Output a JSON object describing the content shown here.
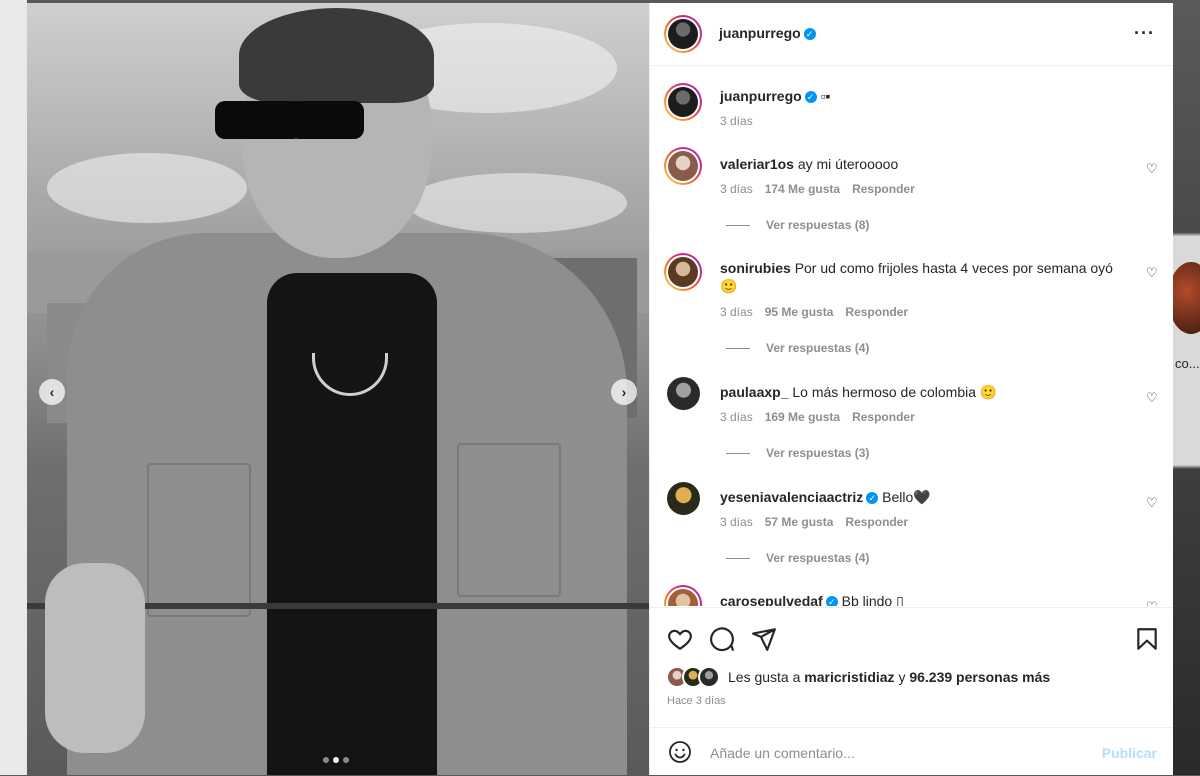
{
  "post": {
    "username": "juanpurrego",
    "caption": "▫▪",
    "caption_time": "3 días",
    "more_icon": "more-horizontal-icon"
  },
  "backdrop": {
    "snippet": "co..."
  },
  "comments": [
    {
      "username": "valeriar1os",
      "verified": false,
      "text": "ay mi úterooooo",
      "time": "3 días",
      "likes": "174 Me gusta",
      "reply": "Responder",
      "replies": "Ver respuestas (8)"
    },
    {
      "username": "sonirubies",
      "verified": false,
      "text": "Por ud como frijoles hasta 4 veces por semana oyó 🙂",
      "time": "3 días",
      "likes": "95 Me gusta",
      "reply": "Responder",
      "replies": "Ver respuestas (4)"
    },
    {
      "username": "paulaaxp_",
      "verified": false,
      "text": "Lo más hermoso de colombia 🙂",
      "time": "3 días",
      "likes": "169 Me gusta",
      "reply": "Responder",
      "replies": "Ver respuestas (3)"
    },
    {
      "username": "yeseniavalenciaactriz",
      "verified": true,
      "text": "Bello🖤",
      "time": "3 días",
      "likes": "57 Me gusta",
      "reply": "Responder",
      "replies": "Ver respuestas (4)"
    },
    {
      "username": "carosepulvedaf",
      "verified": true,
      "text": "Bb lindo ▯"
    }
  ],
  "likes": {
    "prefix": "Les gusta a",
    "user": "maricristidiaz",
    "joiner": "y",
    "count": "96.239 personas más"
  },
  "posted_ago": "Hace 3 días",
  "comment_box": {
    "placeholder": "Añade un comentario...",
    "publish": "Publicar"
  },
  "carousel": {
    "current": 2,
    "total": 3
  }
}
